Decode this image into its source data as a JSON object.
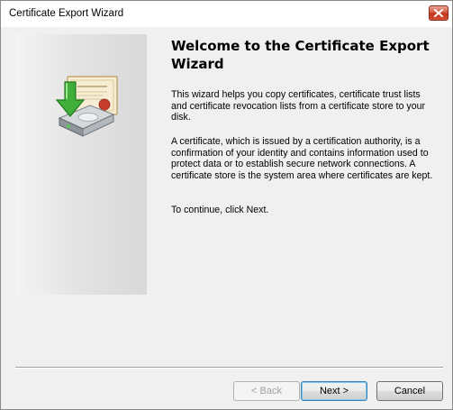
{
  "window": {
    "title": "Certificate Export Wizard",
    "close_icon": "close-x-icon",
    "close_button_color": "#c7402a"
  },
  "side_panel": {
    "icon": "certificate-export-icon"
  },
  "content": {
    "heading": "Welcome to the Certificate Export Wizard",
    "paragraphs": [
      "This wizard helps you copy certificates, certificate trust lists and certificate revocation lists from a certificate store to your disk.",
      "A certificate, which is issued by a certification authority, is a confirmation of your identity and contains information used to protect data or to establish secure network connections. A certificate store is the system area where certificates are kept.",
      "To continue, click Next."
    ]
  },
  "buttons": {
    "back": {
      "label": "< Back",
      "enabled": false
    },
    "next": {
      "label": "Next >",
      "enabled": true,
      "default": true
    },
    "cancel": {
      "label": "Cancel",
      "enabled": true
    }
  }
}
